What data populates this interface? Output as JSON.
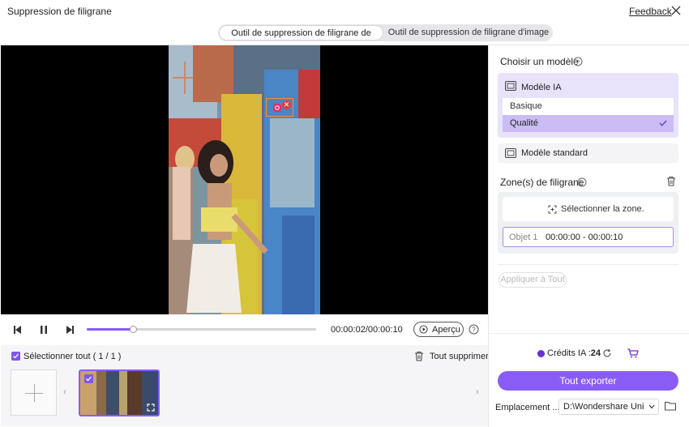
{
  "window": {
    "title": "Suppression de filigrane",
    "feedback_label": "Feedback"
  },
  "tabs": [
    {
      "label": "Outil de suppression de filigrane de vidéo",
      "active": true
    },
    {
      "label": "Outil de suppression de filigrane d'image",
      "active": false
    }
  ],
  "player": {
    "time": "00:00:02/00:00:10",
    "progress_percent": 20,
    "preview_label": "Aperçu"
  },
  "files": {
    "select_all_label": "Sélectionner tout ( 1 / 1 )",
    "delete_all_label": "Tout supprimer"
  },
  "right_panel": {
    "model_title": "Choisir un modèle",
    "ai_model_label": "Modèle IA",
    "options": [
      {
        "label": "Basique",
        "selected": false
      },
      {
        "label": "Qualité",
        "selected": true
      }
    ],
    "standard_model_label": "Modèle standard",
    "zones_title": "Zone(s) de filigrane",
    "select_zone_label": "Sélectionner la zone.",
    "object_name": "Objet 1",
    "object_time": "00:00:00 - 00:00:10",
    "apply_all_label": "Appliquer à Tout",
    "credits_label": "Crédits IA :",
    "credits_value": "24",
    "export_label": "Tout exporter",
    "location_label": "Emplacement ...",
    "location_value": "D:\\Wondershare UniCon"
  },
  "colors": {
    "accent": "#8a5cf6",
    "ai_model_bg": "#e9e2fb",
    "selected_option": "#cbbcf5",
    "watermark_box": "#ff8a2a"
  }
}
